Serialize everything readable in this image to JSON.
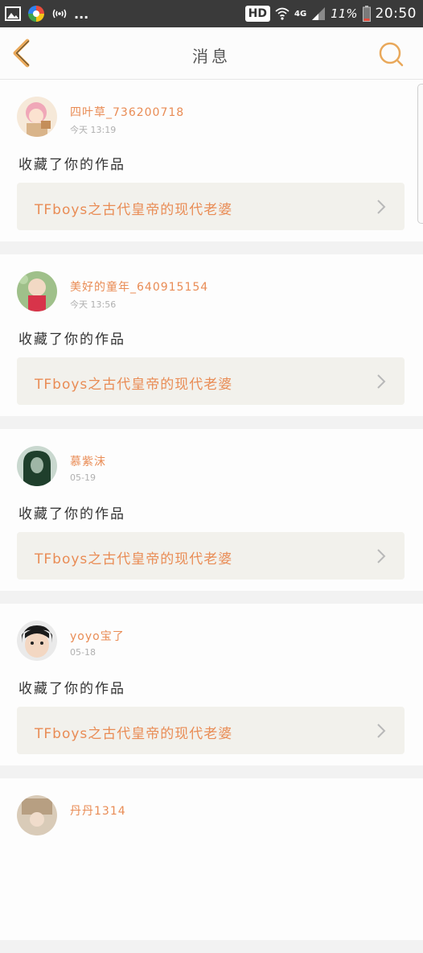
{
  "status_bar": {
    "icons": [
      "image-icon",
      "color-app-icon",
      "wifi-calling-icon",
      "more-dots"
    ],
    "more": "...",
    "hd": "HD",
    "network": "4G",
    "battery_pct": "11%",
    "time": "20:50"
  },
  "nav": {
    "title": "消息",
    "back_icon": "back-chevron-icon",
    "search_icon": "search-icon",
    "accent_color": "#e9a85a"
  },
  "messages": [
    {
      "username": "四叶草_736200718",
      "time": "今天 13:19",
      "action": "收藏了你的作品",
      "work_title": "TFboys之古代皇帝的现代老婆"
    },
    {
      "username": "美好的童年_640915154",
      "time": "今天 13:56",
      "action": "收藏了你的作品",
      "work_title": "TFboys之古代皇帝的现代老婆"
    },
    {
      "username": "慕紫沫",
      "time": "05-19",
      "action": "收藏了你的作品",
      "work_title": "TFboys之古代皇帝的现代老婆"
    },
    {
      "username": "yoyo宝了",
      "time": "05-18",
      "action": "收藏了你的作品",
      "work_title": "TFboys之古代皇帝的现代老婆"
    },
    {
      "username": "丹丹1314",
      "time": "",
      "action": "",
      "work_title": ""
    }
  ],
  "colors": {
    "username": "#e98c55",
    "link_bg": "#f2f1ec"
  }
}
